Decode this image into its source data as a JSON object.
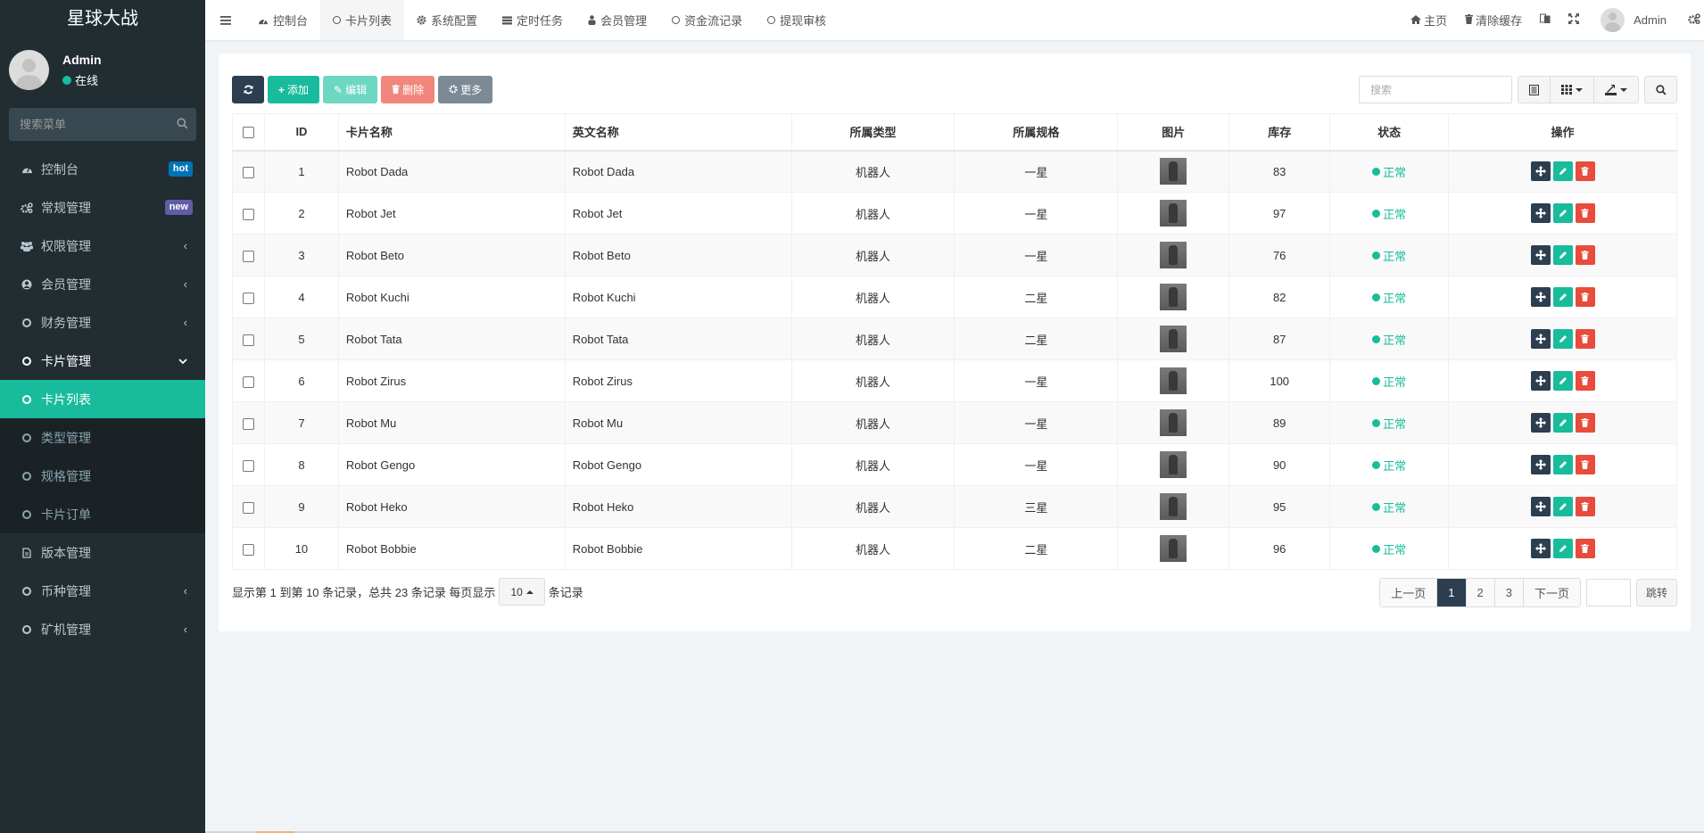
{
  "app": {
    "title": "星球大战"
  },
  "user": {
    "name": "Admin",
    "status": "在线"
  },
  "sidebar": {
    "search_placeholder": "搜索菜单",
    "items": [
      {
        "label": "控制台",
        "icon": "dashboard-icon",
        "badge": "hot"
      },
      {
        "label": "常规管理",
        "icon": "cogs-icon",
        "badge": "new"
      },
      {
        "label": "权限管理",
        "icon": "group-icon",
        "arrow": "‹"
      },
      {
        "label": "会员管理",
        "icon": "user-circle-icon",
        "arrow": "‹"
      },
      {
        "label": "财务管理",
        "icon": "circle-o-icon",
        "arrow": "‹"
      },
      {
        "label": "卡片管理",
        "icon": "circle-o-icon",
        "arrow": "⌄"
      }
    ],
    "submenu": [
      {
        "label": "卡片列表",
        "active": true
      },
      {
        "label": "类型管理"
      },
      {
        "label": "规格管理"
      },
      {
        "label": "卡片订单"
      }
    ],
    "items_after": [
      {
        "label": "版本管理",
        "icon": "file-icon"
      },
      {
        "label": "币种管理",
        "icon": "circle-o-icon",
        "arrow": "‹"
      },
      {
        "label": "矿机管理",
        "icon": "circle-o-icon",
        "arrow": "‹"
      }
    ]
  },
  "topnav": {
    "tabs": [
      {
        "label": "控制台",
        "icon": "dashboard-icon"
      },
      {
        "label": "卡片列表",
        "icon": "circle-o-icon",
        "active": true
      },
      {
        "label": "系统配置",
        "icon": "gear-icon"
      },
      {
        "label": "定时任务",
        "icon": "tasks-icon"
      },
      {
        "label": "会员管理",
        "icon": "user-icon"
      },
      {
        "label": "资金流记录",
        "icon": "circle-o-icon"
      },
      {
        "label": "提现审核",
        "icon": "circle-o-icon"
      }
    ],
    "home": "主页",
    "clear_cache": "清除缓存",
    "user": "Admin"
  },
  "toolbar": {
    "add": "添加",
    "edit": "编辑",
    "delete": "删除",
    "more": "更多",
    "search_placeholder": "搜索"
  },
  "table": {
    "headers": [
      "ID",
      "卡片名称",
      "英文名称",
      "所属类型",
      "所属规格",
      "图片",
      "库存",
      "状态",
      "操作"
    ],
    "rows": [
      {
        "id": "1",
        "name": "Robot Dada",
        "en": "Robot Dada",
        "type": "机器人",
        "spec": "一星",
        "stock": "83",
        "status": "正常"
      },
      {
        "id": "2",
        "name": "Robot Jet",
        "en": "Robot Jet",
        "type": "机器人",
        "spec": "一星",
        "stock": "97",
        "status": "正常"
      },
      {
        "id": "3",
        "name": "Robot Beto",
        "en": "Robot Beto",
        "type": "机器人",
        "spec": "一星",
        "stock": "76",
        "status": "正常"
      },
      {
        "id": "4",
        "name": "Robot Kuchi",
        "en": "Robot Kuchi",
        "type": "机器人",
        "spec": "二星",
        "stock": "82",
        "status": "正常"
      },
      {
        "id": "5",
        "name": "Robot Tata",
        "en": "Robot Tata",
        "type": "机器人",
        "spec": "二星",
        "stock": "87",
        "status": "正常"
      },
      {
        "id": "6",
        "name": "Robot Zirus",
        "en": "Robot Zirus",
        "type": "机器人",
        "spec": "一星",
        "stock": "100",
        "status": "正常"
      },
      {
        "id": "7",
        "name": "Robot Mu",
        "en": "Robot Mu",
        "type": "机器人",
        "spec": "一星",
        "stock": "89",
        "status": "正常"
      },
      {
        "id": "8",
        "name": "Robot Gengo",
        "en": "Robot Gengo",
        "type": "机器人",
        "spec": "一星",
        "stock": "90",
        "status": "正常"
      },
      {
        "id": "9",
        "name": "Robot Heko",
        "en": "Robot Heko",
        "type": "机器人",
        "spec": "三星",
        "stock": "95",
        "status": "正常"
      },
      {
        "id": "10",
        "name": "Robot Bobbie",
        "en": "Robot Bobbie",
        "type": "机器人",
        "spec": "二星",
        "stock": "96",
        "status": "正常"
      }
    ]
  },
  "footer": {
    "info": "显示第 1 到第 10 条记录，总共 23 条记录 每页显示",
    "page_size": "10",
    "suffix": "条记录",
    "prev": "上一页",
    "pages": [
      "1",
      "2",
      "3"
    ],
    "current_page": "1",
    "next": "下一页",
    "jump": "跳转"
  },
  "colors": {
    "accent": "#18bc9c",
    "dark": "#2c3e50",
    "danger": "#e74c3c",
    "sidebar": "#222d32"
  }
}
